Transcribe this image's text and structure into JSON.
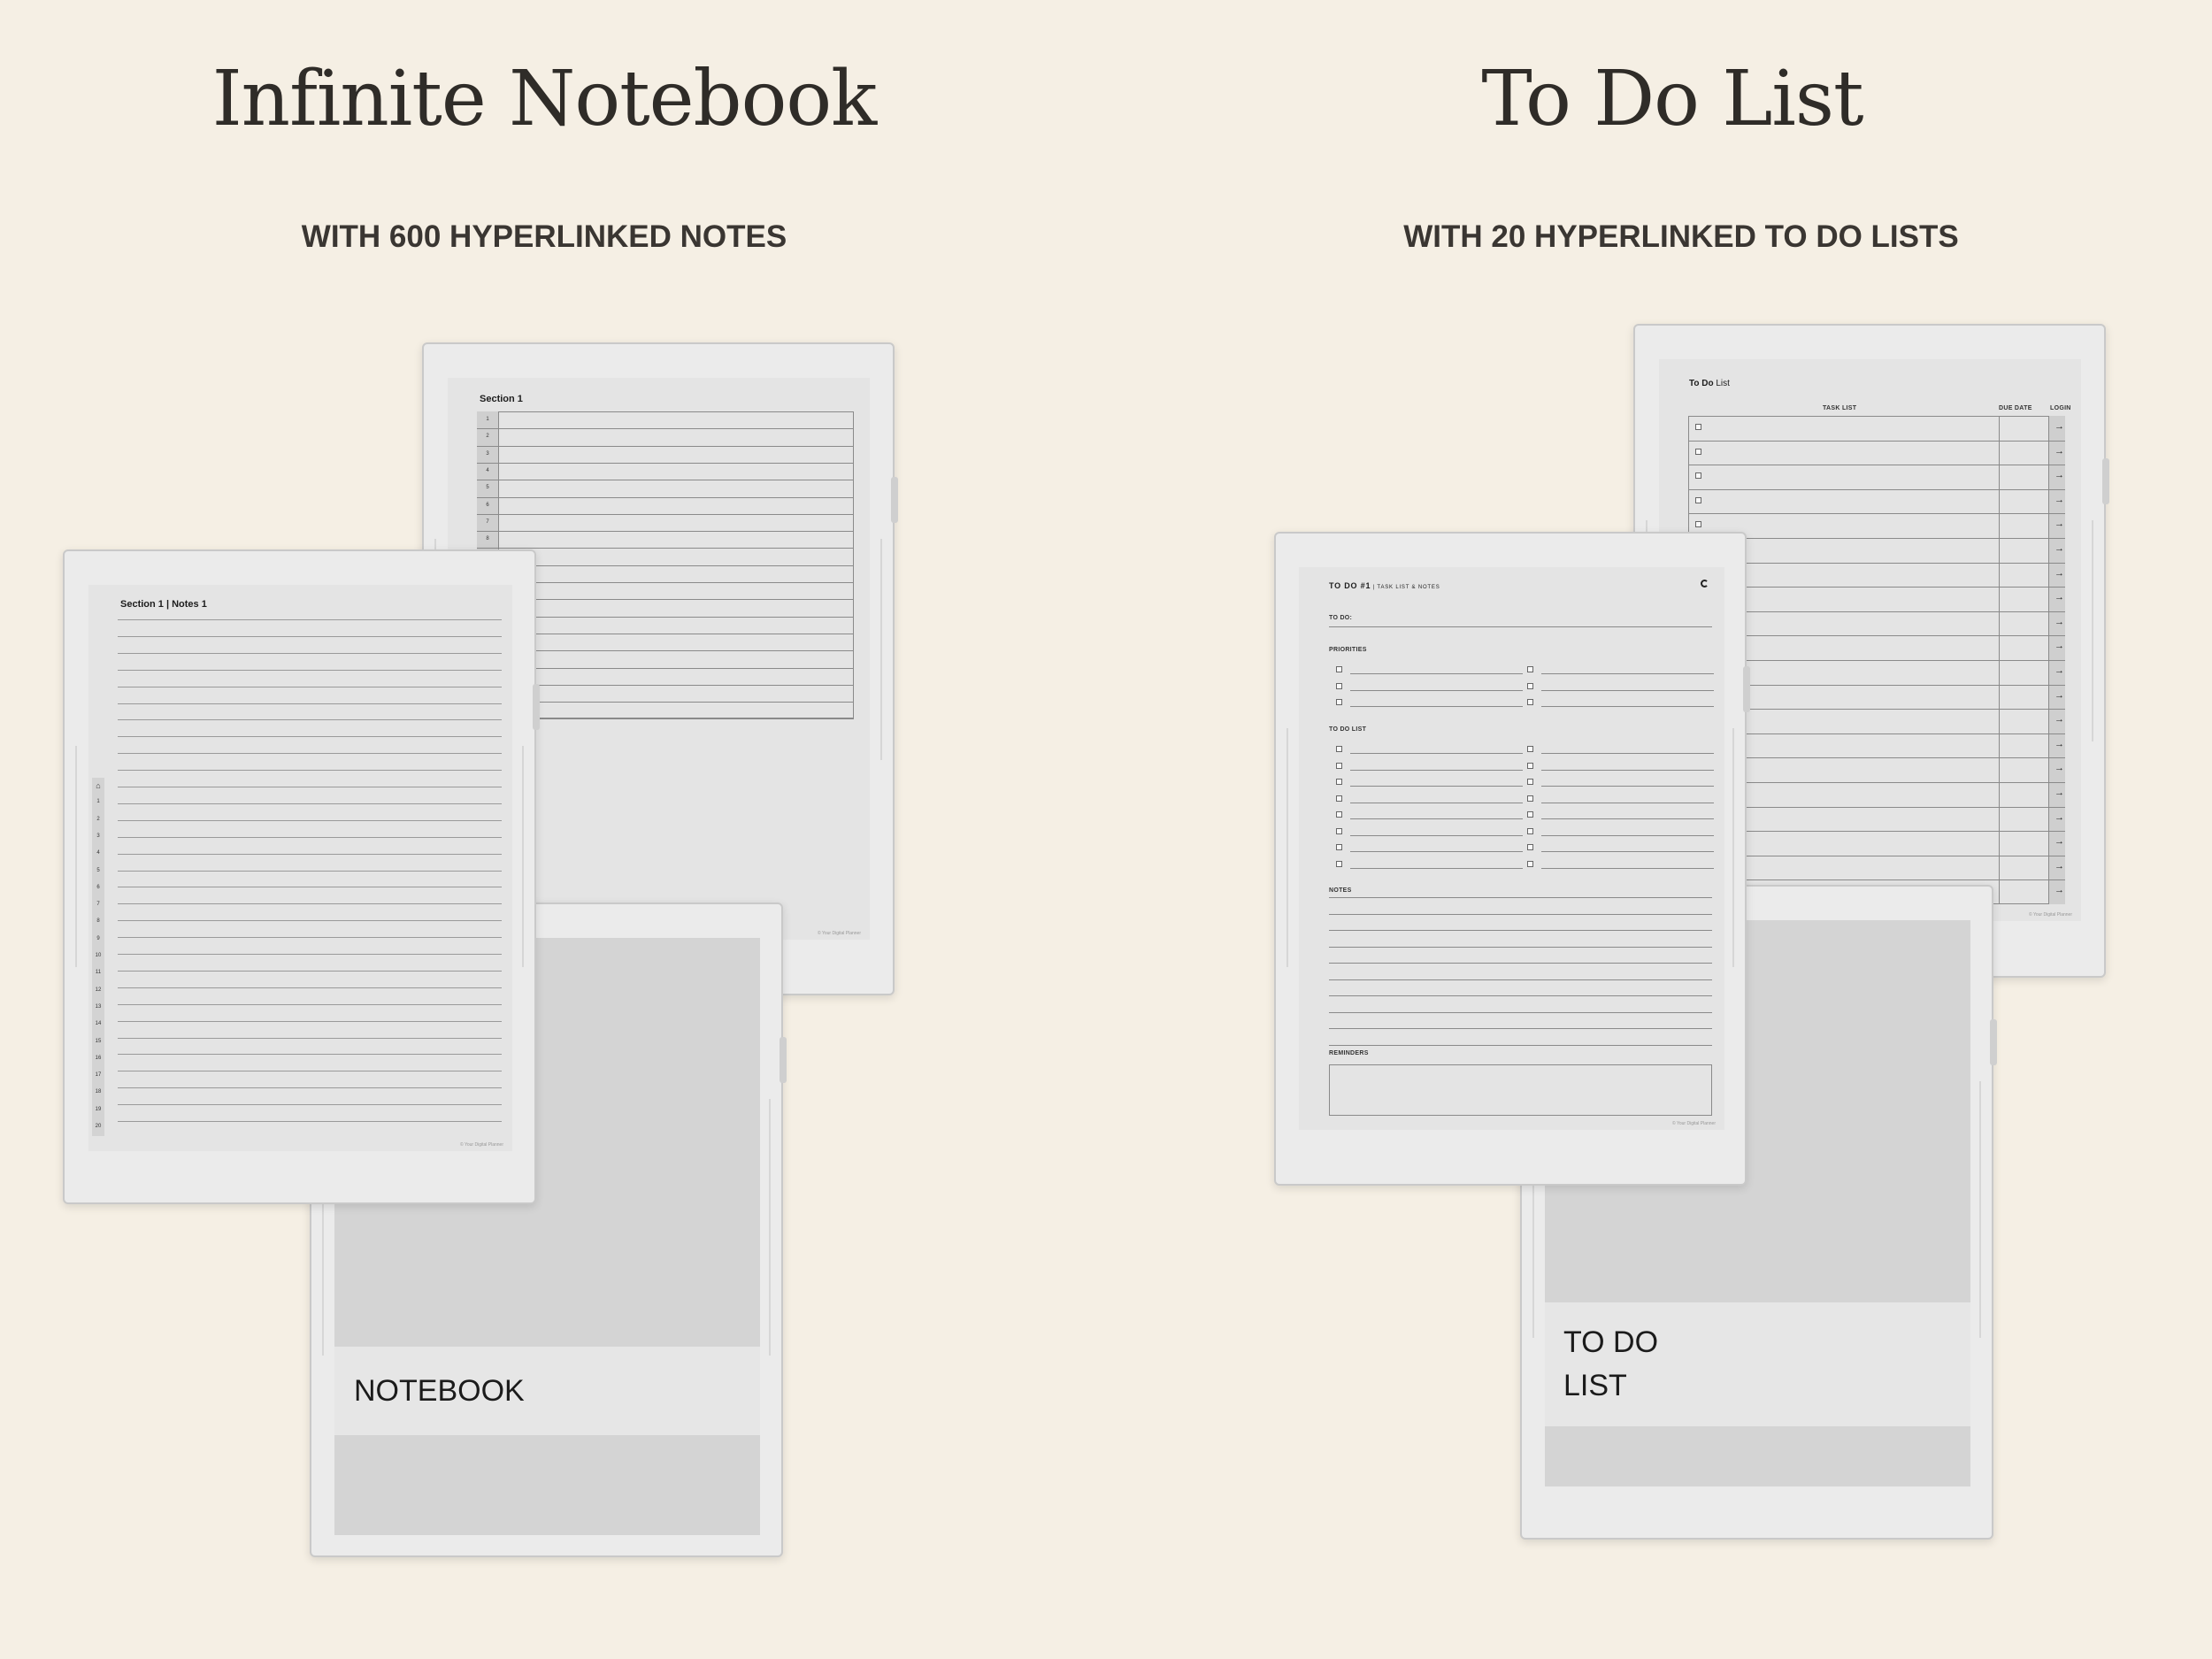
{
  "left": {
    "title": "Infinite Notebook",
    "subtitle": "WITH 600 HYPERLINKED NOTES",
    "index_page": {
      "title": "Section 1",
      "rows": [
        "1",
        "2",
        "3",
        "4",
        "5",
        "6",
        "7",
        "8"
      ]
    },
    "notes_page": {
      "title": "Section 1 | Notes 1",
      "tabs": [
        "1",
        "2",
        "3",
        "4",
        "5",
        "6",
        "7",
        "8",
        "9",
        "10",
        "11",
        "12",
        "13",
        "14",
        "15",
        "16",
        "17",
        "18",
        "19",
        "20"
      ],
      "home_icon": "home-icon"
    },
    "cover": {
      "label": "NOTEBOOK"
    }
  },
  "right": {
    "title": "To Do List",
    "subtitle": "WITH 20 HYPERLINKED TO DO LISTS",
    "index_page": {
      "title_bold": "To Do",
      "title_rest": " List",
      "headers": {
        "task": "TASK LIST",
        "due": "DUE DATE",
        "login": "LOGIN"
      },
      "arrow": "→"
    },
    "todo_page": {
      "title_bold": "TO DO #1",
      "title_rest": " | TASK LIST & NOTES",
      "to_do_label": "TO DO:",
      "priorities_label": "PRIORITIES",
      "todo_list_label": "TO DO LIST",
      "notes_label": "NOTES",
      "reminders_label": "REMINDERS",
      "refresh_icon": "refresh-icon"
    },
    "cover": {
      "line1": "TO DO",
      "line2": "LIST"
    }
  }
}
